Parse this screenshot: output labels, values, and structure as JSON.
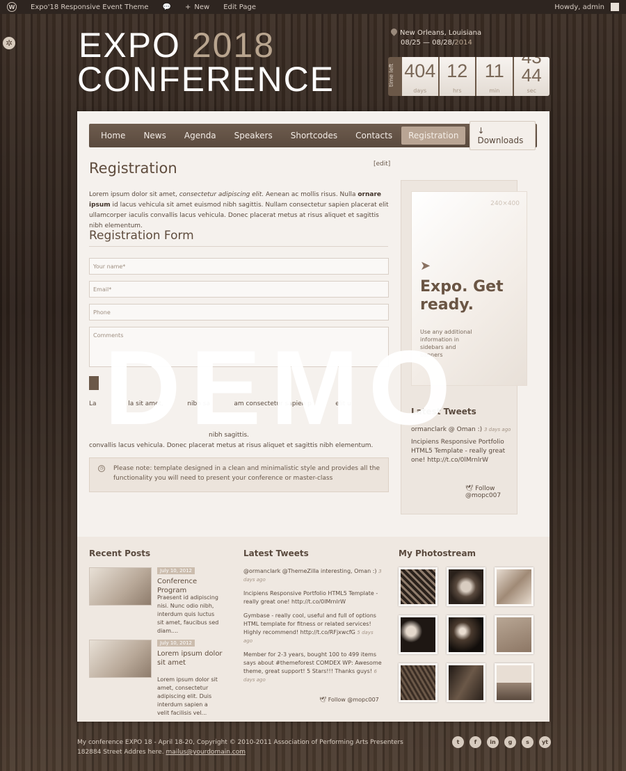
{
  "adminbar": {
    "site_name": "Expo'18 Responsive Event Theme",
    "new_label": "New",
    "edit_label": "Edit Page",
    "howdy": "Howdy, admin"
  },
  "header": {
    "logo_word": "EXPO",
    "logo_year": "2018",
    "logo_line2": "CONFERENCE",
    "location": "New Orleans, Louisiana",
    "dates_main": "08/25 — 08/28/",
    "dates_year": "2014"
  },
  "countdown": {
    "label": "time left",
    "days": "404",
    "days_label": "days",
    "hrs": "12",
    "hrs_label": "hrs",
    "min": "11",
    "min_label": "min",
    "sec_top": "43",
    "sec_bottom": "44",
    "sec_label": "sec"
  },
  "nav": {
    "items": [
      "Home",
      "News",
      "Agenda",
      "Speakers",
      "Shortcodes",
      "Contacts"
    ],
    "registration": "Registration",
    "downloads": "↓ Downloads"
  },
  "main": {
    "title": "Registration",
    "edit": "[edit]",
    "intro_a": "Lorem ipsum dolor sit amet, ",
    "intro_em": "consectetur adipiscing elit.",
    "intro_b": " Aenean ac mollis risus. Nulla ",
    "intro_strong": "ornare ipsum",
    "intro_c": " id lacus vehicula sit amet euismod nibh sagittis. Nullam consectetur sapien placerat elit ullamcorper iaculis convallis lacus vehicula. Donec placerat metus at risus aliquet et sagittis nibh elementum.",
    "form_title": "Registration Form",
    "name_placeholder": "Your name*",
    "email_placeholder": "Email*",
    "phone_placeholder": "Phone",
    "comments_placeholder": "Comments",
    "text2_line1": "La                la sit amet,            nibh sa            am consectetur sapien p            elit u",
    "text2_line2": "nibh sagittis.",
    "text2_last": "convallis lacus vehicula. Donec placerat metus at risus aliquet et sagittis nibh elementum.",
    "notice": "Please note: template designed in a clean and minimalistic style and provides all the functionality you will need to present your conference or master-class",
    "watermark": "DEMO"
  },
  "sidebar": {
    "banner_size": "240×400",
    "banner_title": "Expo. Get ready.",
    "banner_text": "Use any additional information in sidebars and banners",
    "tweets_title": "Latest Tweets",
    "tweet1_text": "ormanclark @ Oman :)",
    "tweet1_ago": "3 days ago",
    "tweet2_text": "Incipiens Responsive Portfolio HTML5 Template - really great one! http://t.co/0lMrnlrW",
    "follow": "Follow @mopc007"
  },
  "widgets": {
    "recent_title": "Recent Posts",
    "posts": [
      {
        "date": "July 10, 2012",
        "title": "Conference Program",
        "excerpt": "Praesent id adipiscing nisi. Nunc odio nibh, interdum quis luctus sit amet, faucibus sed diam...."
      },
      {
        "date": "July 10, 2012",
        "title": "Lorem ipsum dolor sit amet",
        "excerpt": "Lorem ipsum dolor sit amet, consectetur adipiscing elit. Duis interdum sapien a velit facilisis vel..."
      }
    ],
    "tweets_title": "Latest Tweets",
    "tweets": [
      {
        "text": "@ormanclark @ThemeZilla interesting, Oman :)",
        "ago": "3 days ago"
      },
      {
        "text": "Incipiens Responsive Portfolio HTML5 Template - really great one! http://t.co/0lMrnlrW",
        "ago": "5 days ago"
      },
      {
        "text": "Gymbase - really cool, useful and full of options HTML template for fitness or related services! Highly recommend! http://t.co/RFjxwcfG",
        "ago": "5 days ago"
      },
      {
        "text": "Member for 2-3 years, bought 100 to 499 items says about #themeforest COMDEX WP: Awesome theme, great support! 5 Stars!!! Thanks guys!",
        "ago": "6 days ago"
      }
    ],
    "follow": "Follow @mopc007",
    "photostream_title": "My Photostream"
  },
  "footer": {
    "line1": "My conference EXPO 18 - April 18-20, Copyright © 2010-2011 Association of Performing Arts Presenters",
    "line2": "182884 Street Addres here. ",
    "email": "mailus@yourdomain.com",
    "socials": [
      "t",
      "f",
      "in",
      "g",
      "s",
      "yt"
    ]
  }
}
